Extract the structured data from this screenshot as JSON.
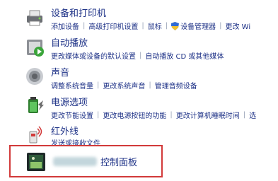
{
  "categories": [
    {
      "title": "设备和打印机",
      "icon": "printer-icon",
      "links": [
        "添加设备",
        "高级打印机设置",
        "鼠标",
        "设备管理器",
        "更改 Wi"
      ]
    },
    {
      "title": "自动播放",
      "icon": "autoplay-icon",
      "links": [
        "更改媒体或设备的默认设置",
        "自动播放 CD 或其他媒体"
      ]
    },
    {
      "title": "声音",
      "icon": "speaker-icon",
      "links": [
        "调整系统音量",
        "更改系统声音",
        "管理音频设备"
      ]
    },
    {
      "title": "电源选项",
      "icon": "power-options-icon",
      "links": [
        "更改节能设置",
        "更改电源按钮的功能",
        "更改计算机睡眠时间",
        "选"
      ]
    },
    {
      "title": "红外线",
      "icon": "infrared-icon",
      "links": [
        "发送或接收文件"
      ]
    }
  ],
  "highlighted_item": {
    "title": "控制面板",
    "icon": "control-panel-icon",
    "border_color": "#d23a3a"
  },
  "colors": {
    "link": "#1e3287",
    "separator": "#9aa4b8"
  }
}
